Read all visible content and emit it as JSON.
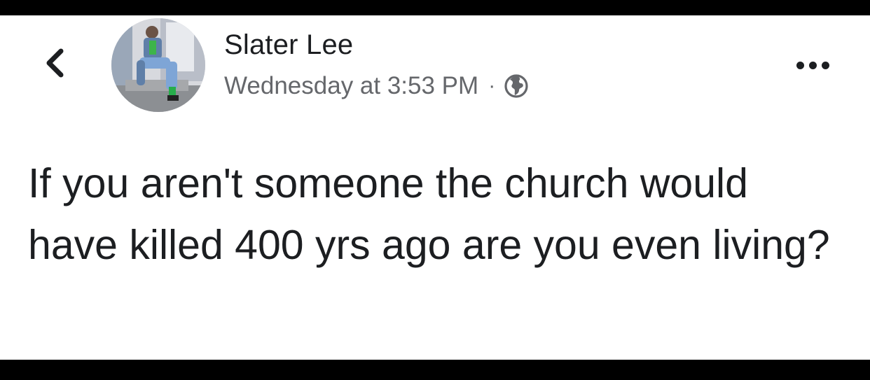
{
  "post": {
    "author_name": "Slater Lee",
    "timestamp": "Wednesday at 3:53 PM",
    "separator": "·",
    "privacy_icon": "globe-icon",
    "text": "If you aren't someone the church would have killed 400 yrs ago are you even living?"
  },
  "icons": {
    "back": "chevron-left-icon",
    "more": "more-horizontal-icon"
  },
  "colors": {
    "text_primary": "#1c1e21",
    "text_secondary": "#65676b",
    "background": "#ffffff",
    "frame": "#000000"
  }
}
